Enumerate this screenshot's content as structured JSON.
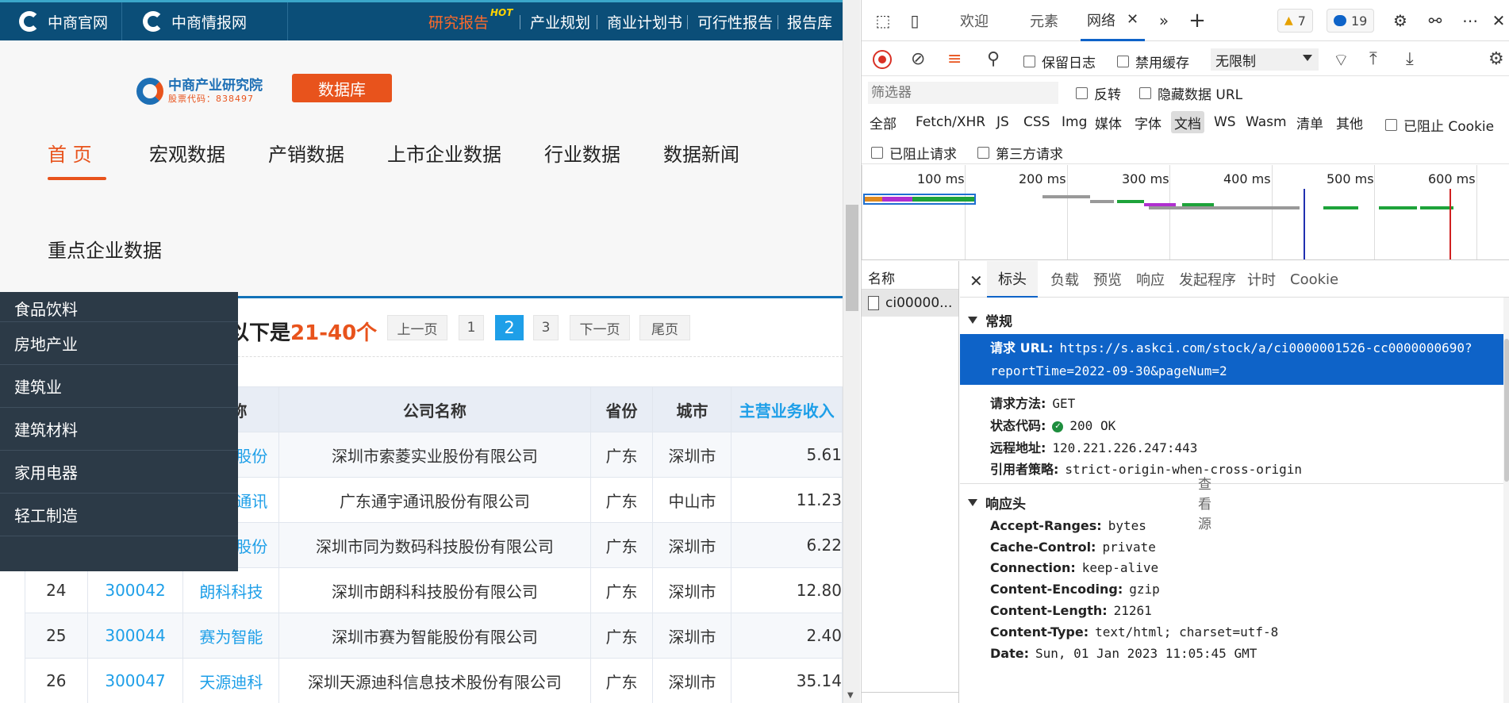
{
  "site": {
    "topbar": {
      "logo1": "中商官网",
      "logo2": "中商情报网",
      "nav": [
        "研究报告",
        "产业规划",
        "商业计划书",
        "可行性报告",
        "报告库"
      ],
      "hot": "HOT"
    },
    "brand": {
      "name": "中商产业研究院",
      "stock_code": "股票代码：838497"
    },
    "db_button": "数据库",
    "main_nav": [
      "首 页",
      "宏观数据",
      "产销数据",
      "上市企业数据",
      "行业数据",
      "数据新闻"
    ],
    "key_nav": "重点企业数据",
    "showing_prefix": "以下是",
    "showing_range": "21-40个",
    "pager": {
      "prev": "上一页",
      "pages": [
        "1",
        "2",
        "3"
      ],
      "current": "2",
      "next": "下一页",
      "last": "尾页"
    },
    "table": {
      "headers": [
        "",
        "",
        "简称",
        "公司名称",
        "省份",
        "城市",
        "主营业务收入"
      ],
      "rows": [
        [
          "",
          "",
          "股份",
          "深圳市索菱实业股份有限公司",
          "广东",
          "深圳市",
          "5.61"
        ],
        [
          "",
          "",
          "通讯",
          "广东通宇通讯股份有限公司",
          "广东",
          "中山市",
          "11.23"
        ],
        [
          "",
          "",
          "股份",
          "深圳市同为数码科技股份有限公司",
          "广东",
          "深圳市",
          "6.22"
        ],
        [
          "24",
          "300042",
          "朗科科技",
          "深圳市朗科科技股份有限公司",
          "广东",
          "深圳市",
          "12.80"
        ],
        [
          "25",
          "300044",
          "赛为智能",
          "深圳市赛为智能股份有限公司",
          "广东",
          "深圳市",
          "2.40"
        ],
        [
          "26",
          "300047",
          "天源迪科",
          "深圳天源迪科信息技术股份有限公司",
          "广东",
          "深圳市",
          "35.14"
        ]
      ]
    },
    "dropdown": [
      "食品饮料",
      "房地产业",
      "建筑业",
      "建筑材料",
      "家用电器",
      "轻工制造"
    ]
  },
  "devtools": {
    "tabs": [
      "欢迎",
      "元素",
      "网络"
    ],
    "active_tab": "网络",
    "warnings": "7",
    "messages": "19",
    "toolbar": {
      "preserve_log": "保留日志",
      "disable_cache": "禁用缓存",
      "throttle": "无限制"
    },
    "filter": {
      "placeholder": "筛选器",
      "invert": "反转",
      "hide_data_url": "隐藏数据 URL"
    },
    "types": [
      "全部",
      "Fetch/XHR",
      "JS",
      "CSS",
      "Img",
      "媒体",
      "字体",
      "文档",
      "WS",
      "Wasm",
      "清单",
      "其他"
    ],
    "active_type": "文档",
    "blocked_cookies": "已阻止 Cookie",
    "blocked_requests": "已阻止请求",
    "third_party": "第三方请求",
    "timeline_labels": [
      "100 ms",
      "200 ms",
      "300 ms",
      "400 ms",
      "500 ms",
      "600 ms"
    ],
    "request_list": {
      "header": "名称",
      "item": "ci00000..."
    },
    "detail_tabs": [
      "标头",
      "负载",
      "预览",
      "响应",
      "发起程序",
      "计时",
      "Cookie"
    ],
    "general": {
      "title": "常规",
      "url_key": "请求 URL:",
      "url_line1": "https://s.askci.com/stock/a/ci0000001526-cc0000000690?",
      "url_line2": "reportTime=2022-09-30&pageNum=2",
      "method_key": "请求方法:",
      "method": "GET",
      "status_key": "状态代码:",
      "status": "200 OK",
      "remote_key": "远程地址:",
      "remote": "120.221.226.247:443",
      "referrer_key": "引用者策略:",
      "referrer": "strict-origin-when-cross-origin"
    },
    "response_headers": {
      "title": "响应头",
      "view_source": "查看源",
      "items": [
        [
          "Accept-Ranges:",
          "bytes"
        ],
        [
          "Cache-Control:",
          "private"
        ],
        [
          "Connection:",
          "keep-alive"
        ],
        [
          "Content-Encoding:",
          "gzip"
        ],
        [
          "Content-Length:",
          "21261"
        ],
        [
          "Content-Type:",
          "text/html; charset=utf-8"
        ],
        [
          "Date:",
          "Sun, 01 Jan 2023 11:05:45 GMT"
        ]
      ]
    }
  }
}
